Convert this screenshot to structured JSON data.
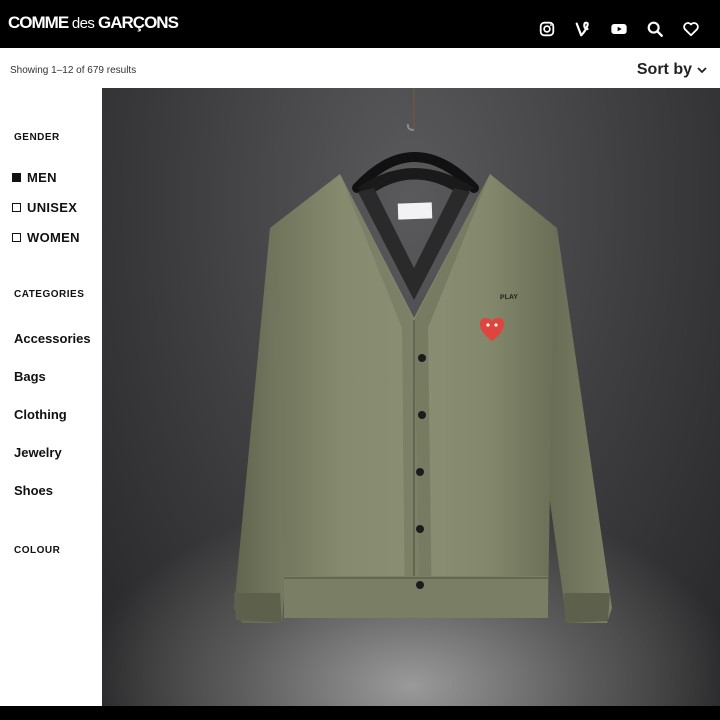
{
  "header": {
    "logo_prefix": "COMME",
    "logo_middle": "des",
    "logo_suffix": "GARÇONS",
    "icons": [
      "instagram-icon",
      "vine-icon",
      "youtube-icon",
      "search-icon",
      "heart-icon"
    ]
  },
  "toolbar": {
    "results_text": "Showing 1–12 of 679 results",
    "sort_label": "Sort by"
  },
  "sidebar": {
    "gender_title": "GENDER",
    "gender_items": [
      {
        "label": "MEN",
        "checked": true
      },
      {
        "label": "UNISEX",
        "checked": false
      },
      {
        "label": "WOMEN",
        "checked": false
      }
    ],
    "categories_title": "CATEGORIES",
    "categories": [
      "Accessories",
      "Bags",
      "Clothing",
      "Jewelry",
      "Shoes"
    ],
    "colour_title": "COLOUR"
  },
  "product": {
    "tag_text": "PLAY",
    "garment_color": "#7f8368",
    "heart_color": "#e0443f"
  }
}
